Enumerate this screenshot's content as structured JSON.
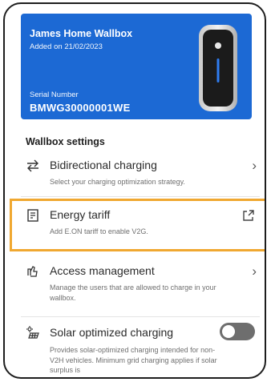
{
  "wallbox": {
    "name": "James Home Wallbox",
    "added": "Added on 21/02/2023",
    "serial_label": "Serial Number",
    "serial_number": "BMWG30000001WE"
  },
  "settings": {
    "title": "Wallbox settings",
    "items": [
      {
        "label": "Bidirectional charging",
        "description": "Select your charging optimization strategy.",
        "icon": "swap-arrows-icon",
        "action": "chevron-right-icon"
      },
      {
        "label": "Energy tariff",
        "description": "Add E.ON tariff to enable V2G.",
        "icon": "tariff-document-icon",
        "action": "external-link-icon"
      },
      {
        "label": "Access management",
        "description": "Manage the users that are allowed to charge in your wallbox.",
        "icon": "hand-access-icon",
        "action": "chevron-right-icon"
      },
      {
        "label": "Solar optimized charging",
        "description": "Provides solar-optimized charging intended for non-V2H vehicles. Minimum grid charging applies if solar surplus is",
        "icon": "solar-panel-icon",
        "toggle": "off"
      }
    ]
  },
  "colors": {
    "accent": "#1c69d4",
    "highlight": "#f0a830"
  }
}
